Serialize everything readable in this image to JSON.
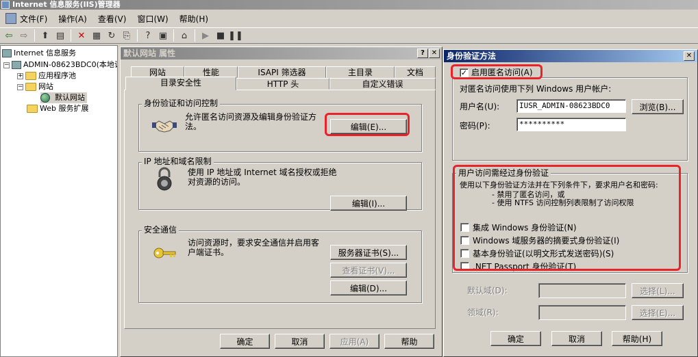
{
  "window": {
    "title": "Internet 信息服务(IIS)管理器"
  },
  "menu": [
    "文件(F)",
    "操作(A)",
    "查看(V)",
    "窗口(W)",
    "帮助(H)"
  ],
  "tree": {
    "root": "Internet 信息服务",
    "computer": "ADMIN-08623BDC0(本地计",
    "app_pools": "应用程序池",
    "websites": "网站",
    "default_site": "默认网站",
    "web_ext": "Web 服务扩展"
  },
  "props": {
    "title": "默认网站 属性",
    "tabs_row1": [
      "网站",
      "性能",
      "ISAPI 筛选器",
      "主目录",
      "文档"
    ],
    "tabs_row2": [
      "目录安全性",
      "HTTP 头",
      "自定义错误"
    ],
    "auth_group": "身份验证和访问控制",
    "auth_desc": "允许匿名访问资源及编辑身份验证方法。",
    "auth_edit": "编辑(E)...",
    "ip_group": "IP 地址和域名限制",
    "ip_desc": "使用 IP 地址或 Internet 域名授权或拒绝对资源的访问。",
    "ip_edit": "编辑(I)...",
    "sec_group": "安全通信",
    "sec_desc": "访问资源时，要求安全通信并启用客户端证书。",
    "server_cert": "服务器证书(S)...",
    "view_cert": "查看证书(V)...",
    "sec_edit": "编辑(D)...",
    "ok": "确定",
    "cancel": "取消",
    "apply": "应用(A)",
    "help": "帮助"
  },
  "auth": {
    "title": "身份验证方法",
    "anon_label": "启用匿名访问(A)",
    "anon_checked": true,
    "anon_desc": "对匿名访问使用下列 Windows 用户帐户:",
    "username_label": "用户名(U):",
    "username_value": "IUSR_ADMIN-08623BDC0",
    "browse": "浏览(B)...",
    "password_label": "密码(P):",
    "password_value": "**********",
    "auth_group": "用户访问需经过身份验证",
    "auth_desc1": "使用以下身份验证方法并在下列条件下，要求用户名和密码:",
    "auth_desc2": "- 禁用了匿名访问，或",
    "auth_desc3": "- 使用 NTFS 访问控制列表限制了访问权限",
    "methods": [
      {
        "label": "集成 Windows 身份验证(N)",
        "checked": false
      },
      {
        "label": "Windows 域服务器的摘要式身份验证(I)",
        "checked": false
      },
      {
        "label": "基本身份验证(以明文形式发送密码)(S)",
        "checked": false
      },
      {
        "label": ".NET Passport 身份验证(T)",
        "checked": false
      }
    ],
    "default_domain_label": "默认域(D):",
    "realm_label": "领域(R):",
    "select1": "选择(L)...",
    "select2": "选择(E)...",
    "ok": "确定",
    "cancel": "取消",
    "help": "帮助(H)"
  },
  "colors": {
    "highlight": "#e8232a",
    "active_title": "#0a246a"
  }
}
